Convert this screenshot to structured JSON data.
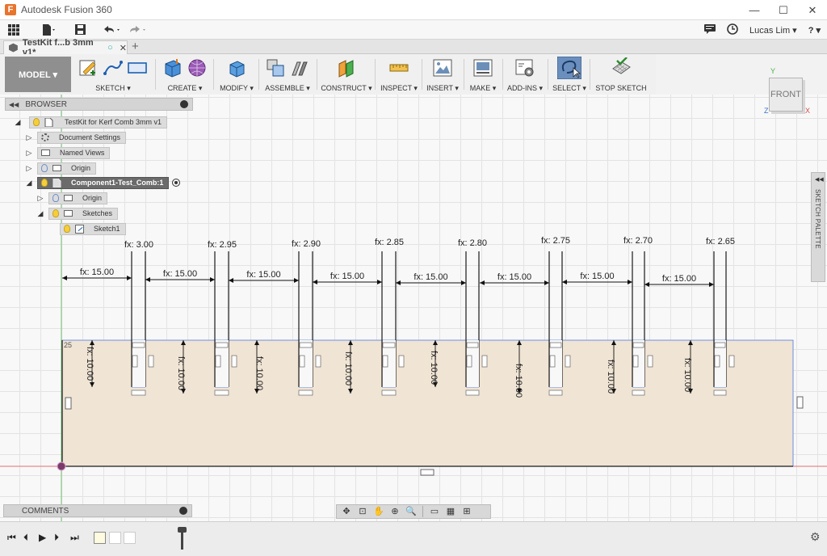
{
  "window": {
    "title": "Autodesk Fusion 360",
    "controls": {
      "minimize": "—",
      "maximize": "☐",
      "close": "✕"
    }
  },
  "quick_access": {
    "user": "Lucas Lim ▾",
    "help": "? ▾"
  },
  "document_tab": {
    "label": "TestKit f...b 3mm v1*",
    "status_icon": "○",
    "close": "✕",
    "new_tab": "+"
  },
  "ribbon": {
    "workspace": "MODEL ▾",
    "groups": [
      {
        "id": "sketch",
        "label": "SKETCH ▾"
      },
      {
        "id": "create",
        "label": "CREATE ▾"
      },
      {
        "id": "modify",
        "label": "MODIFY ▾"
      },
      {
        "id": "assemble",
        "label": "ASSEMBLE ▾"
      },
      {
        "id": "construct",
        "label": "CONSTRUCT ▾"
      },
      {
        "id": "inspect",
        "label": "INSPECT ▾"
      },
      {
        "id": "insert",
        "label": "INSERT ▾"
      },
      {
        "id": "make",
        "label": "MAKE ▾"
      },
      {
        "id": "addins",
        "label": "ADD-INS ▾"
      },
      {
        "id": "select",
        "label": "SELECT ▾"
      },
      {
        "id": "stop_sketch",
        "label": "STOP SKETCH"
      }
    ]
  },
  "browser": {
    "title": "BROWSER",
    "items": [
      {
        "label": "TestKit for Kerf Comb 3mm v1"
      },
      {
        "label": "Document Settings"
      },
      {
        "label": "Named Views"
      },
      {
        "label": "Origin"
      },
      {
        "label": "Component1-Test_Comb:1"
      },
      {
        "label": "Origin"
      },
      {
        "label": "Sketches"
      },
      {
        "label": "Sketch1"
      }
    ]
  },
  "viewcube": {
    "face": "FRONT",
    "axis_y": "Y",
    "axis_z": "Z",
    "axis_x": "X"
  },
  "sketch_palette": {
    "label": "SKETCH PALETTE"
  },
  "comments": {
    "title": "COMMENTS"
  },
  "sketch": {
    "slot_width_dims": [
      "fx: 3.00",
      "fx: 2.95",
      "fx: 2.90",
      "fx: 2.85",
      "fx: 2.80",
      "fx: 2.75",
      "fx: 2.70",
      "fx: 2.65"
    ],
    "spacing_dims": [
      "fx: 15.00",
      "fx: 15.00",
      "fx: 15.00",
      "fx: 15.00",
      "fx: 15.00",
      "fx: 15.00",
      "fx: 15.00",
      "fx: 15.00"
    ],
    "depth_dims": [
      "fx: 10.00",
      "fx: 10.00",
      "fx: 10.00",
      "fx: 10.00",
      "fx: 10.00",
      "fx: 10.00",
      "fx: 10.00",
      "fx: 10.00"
    ],
    "corner_dim": "25",
    "colors": {
      "profile_fill": "#f0e4d4",
      "profile_edge": "#1a1a1a",
      "bounding_line": "#6b8fe0",
      "x_axis": "#e07070",
      "y_axis": "#6fc06f"
    }
  }
}
